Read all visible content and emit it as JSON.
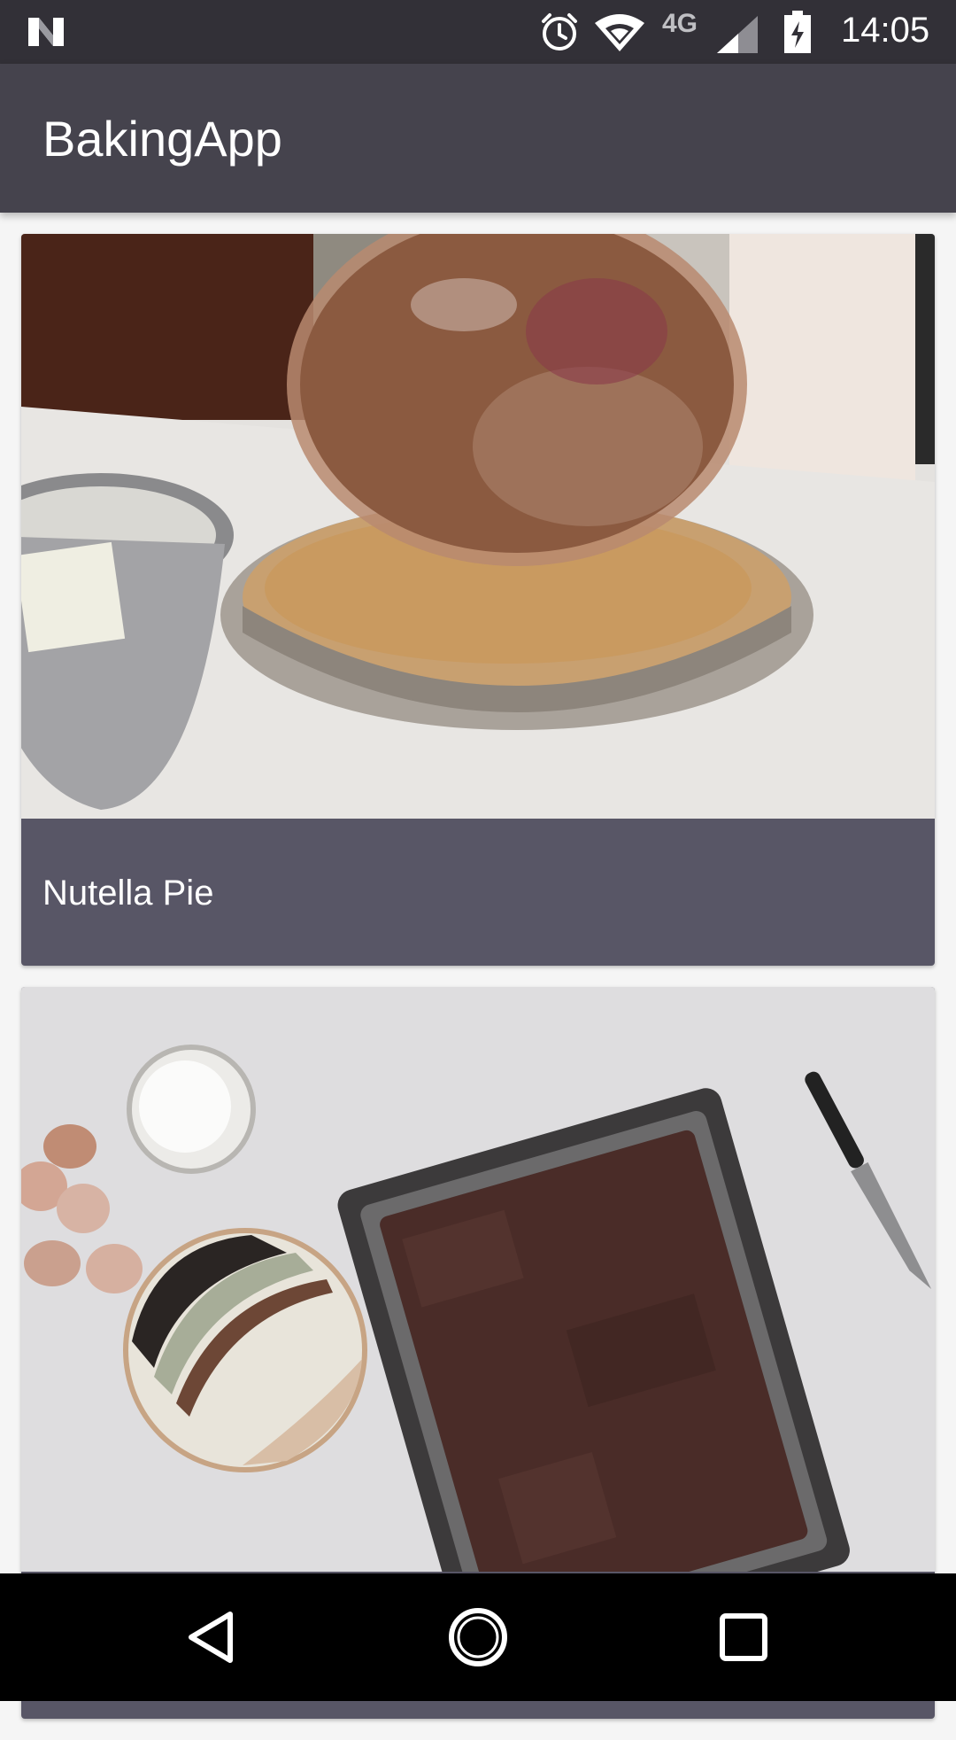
{
  "status_bar": {
    "network_type": "4G",
    "time": "14:05",
    "icons": [
      "n-logo-icon",
      "alarm-icon",
      "wifi-icon",
      "signal-icon",
      "battery-charging-icon"
    ]
  },
  "app_bar": {
    "title": "BakingApp"
  },
  "recipes": [
    {
      "name": "Nutella Pie",
      "image": "pie-crust-photo"
    },
    {
      "name": "",
      "image": "brownie-pan-photo"
    }
  ],
  "nav_bar": {
    "icons": [
      "back-icon",
      "home-icon",
      "recents-icon"
    ]
  },
  "colors": {
    "status_bar": "#323037",
    "app_bar": "#45434d",
    "card_caption": "#585666",
    "background": "#f5f5f5"
  }
}
